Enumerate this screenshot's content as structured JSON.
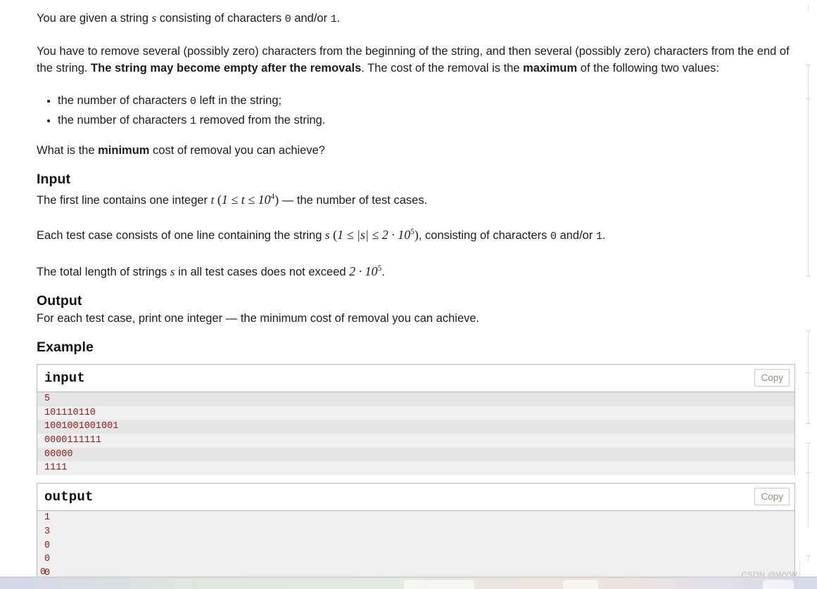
{
  "statement": {
    "p1": {
      "before": "You are given a string ",
      "var": "s",
      "mid": " consisting of characters ",
      "code0": "0",
      "mid2": " and/or ",
      "code1": "1",
      "after": "."
    },
    "p2": {
      "part1": "You have to remove several (possibly zero) characters from the beginning of the string, and then several (possibly zero) characters from the end of the string. ",
      "bold1": "The string may become empty after the removals",
      "part2": ". The cost of the removal is the ",
      "bold2": "maximum",
      "part3": " of the following two values:"
    },
    "bullets": [
      {
        "before": "the number of characters ",
        "code": "0",
        "after": " left in the string;"
      },
      {
        "before": "the number of characters ",
        "code": "1",
        "after": " removed from the string."
      }
    ],
    "p3": {
      "before": "What is the ",
      "bold": "minimum",
      "after": " cost of removal you can achieve?"
    }
  },
  "input_section": {
    "heading": "Input",
    "p1": {
      "before": "The first line contains one integer ",
      "var": "t",
      "math_open": "(",
      "math": "1 ≤ t ≤ 10",
      "exp": "4",
      "math_close": ")",
      "after": " — the number of test cases."
    },
    "p2": {
      "before": "Each test case consists of one line containing the string ",
      "var": "s",
      "math_open": "(",
      "math_a": "1 ≤ |s| ≤ 2 · 10",
      "exp": "5",
      "math_close": ")",
      "mid": ", consisting of characters ",
      "code0": "0",
      "mid2": " and/or ",
      "code1": "1",
      "after": "."
    },
    "p3": {
      "before": "The total length of strings ",
      "var": "s",
      "mid": " in all test cases does not exceed ",
      "math": "2 · 10",
      "exp": "5",
      "after": "."
    }
  },
  "output_section": {
    "heading": "Output",
    "text": "For each test case, print one integer — the minimum cost of removal you can achieve."
  },
  "example_section": {
    "heading": "Example",
    "input_block": {
      "title": "input",
      "copy_label": "Copy",
      "lines": [
        "5",
        "101110110",
        "1001001001001",
        "0000111111",
        "00000",
        "1111"
      ]
    },
    "output_block": {
      "title": "output",
      "copy_label": "Copy",
      "lines": [
        "1",
        "3",
        "0",
        "0",
        "0"
      ]
    }
  },
  "watermark": {
    "text": "CSDN @WYW"
  },
  "colors": {
    "sample_text": "#8b1a1a",
    "stripe_dark": "#e4e4e4",
    "stripe_light": "#f0f0f0",
    "border": "#b8b8b8",
    "copy_text": "#9a8f80"
  }
}
